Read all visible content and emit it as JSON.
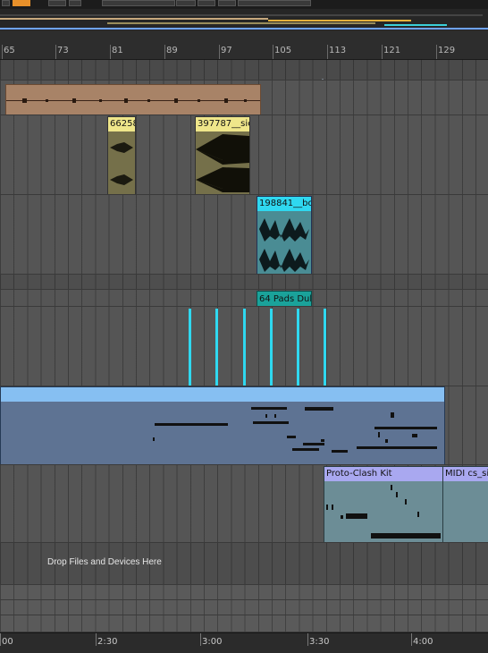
{
  "ruler": {
    "bar_labels": [
      "65",
      "73",
      "81",
      "89",
      "97",
      "105",
      "113",
      "121",
      "129"
    ]
  },
  "clips": {
    "audio1_name": "",
    "audio2a_name": "66258",
    "audio2b_name": "397787__sie",
    "audio3_name": "198841__bo",
    "midi_pad_name": "64 Pads Dub",
    "proto_clash_name": "Proto-Clash Kit",
    "midi_cs_name": "MIDI cs_si"
  },
  "drop_zone": {
    "label": "Drop Files and Devices Here"
  },
  "time_ruler": {
    "labels": [
      "00",
      "2:30",
      "3:00",
      "3:30",
      "4:00"
    ]
  },
  "colors": {
    "orange_clip": "#a88367",
    "yellow_clip": "#efe68a",
    "cyan_clip": "#2fd8f0",
    "teal_clip": "#1aa29a",
    "blue_clip": "#86bff2",
    "purple_clip": "#a9a8f0",
    "toolbar_accent": "#e8902a"
  }
}
